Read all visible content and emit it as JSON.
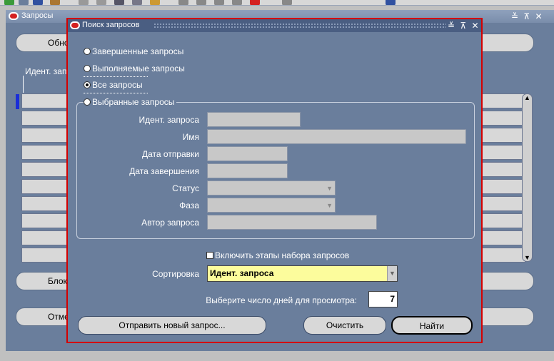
{
  "toolbar": {
    "icons": [
      "new-icon",
      "save-icon",
      "lock-icon",
      "print-icon",
      "tools-icon",
      "cut-icon",
      "copy-icon",
      "paste-icon",
      "edit-icon",
      "clear-icon",
      "close-icon",
      "folder-icon",
      "ledger-icon",
      "lamp-icon",
      "clip-icon",
      "help-icon"
    ]
  },
  "background_window": {
    "title": "Запросы",
    "buttons": {
      "refresh": "Обновить",
      "hold": "Блокировать",
      "cancel": "Отменить"
    },
    "column_header": "Идент. запроса",
    "row_count": 10
  },
  "dialog": {
    "title": "Поиск запросов",
    "radios": {
      "completed": "Завершенные запросы",
      "running": "Выполняемые запросы",
      "all": "Все запросы",
      "specific": "Выбранные запросы"
    },
    "selected_radio": "all",
    "fields": {
      "request_id_label": "Идент. запроса",
      "name_label": "Имя",
      "submitted_label": "Дата отправки",
      "completed_label": "Дата завершения",
      "status_label": "Статус",
      "phase_label": "Фаза",
      "requestor_label": "Автор запроса"
    },
    "include_stages_label": "Включить этапы набора запросов",
    "sort_label": "Сортировка",
    "sort_value": "Идент. запроса",
    "days_label": "Выберите число дней для просмотра:",
    "days_value": "7",
    "buttons": {
      "submit_new": "Отправить новый запрос...",
      "clear": "Очистить",
      "find": "Найти"
    },
    "window_controls": "≚ ⊼ ✕"
  }
}
